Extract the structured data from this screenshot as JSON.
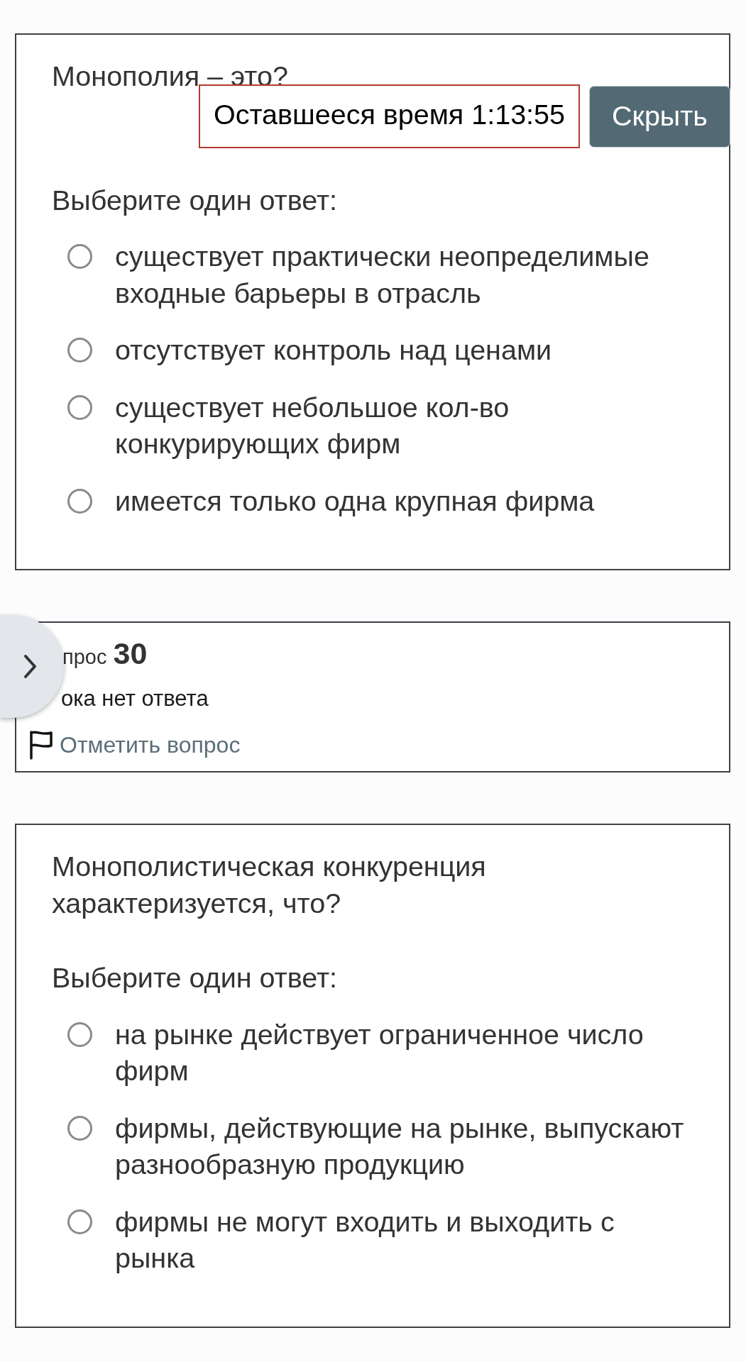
{
  "timer": {
    "label": "Оставшееся время 1:13:55",
    "hide_button": "Скрыть"
  },
  "blocks": [
    {
      "kind": "content",
      "question": "Монополия – это?",
      "prompt": "Выберите один ответ:",
      "options": [
        {
          "text": "существует практически неопределимые входные барьеры в отрасль",
          "selected": false
        },
        {
          "text": "отсутствует контроль над ценами",
          "selected": false
        },
        {
          "text": "существует небольшое кол-во конкурирующих фирм",
          "selected": false
        },
        {
          "text": "имеется только одна крупная фирма",
          "selected": false
        }
      ]
    },
    {
      "kind": "info",
      "label": "прос",
      "number": "30",
      "status": "ока нет ответа",
      "flag_link": "Отметить вопрос"
    },
    {
      "kind": "content",
      "question": "Монополистическая конкуренция характеризуется, что?",
      "prompt": "Выберите один ответ:",
      "options": [
        {
          "text": "на рынке действует ограниченное число фирм",
          "selected": false
        },
        {
          "text": "фирмы, действующие на рынке, выпускают разнообразную продукцию",
          "selected": false
        },
        {
          "text": "фирмы не могут входить и выходить с рынка",
          "selected": false
        }
      ]
    }
  ]
}
